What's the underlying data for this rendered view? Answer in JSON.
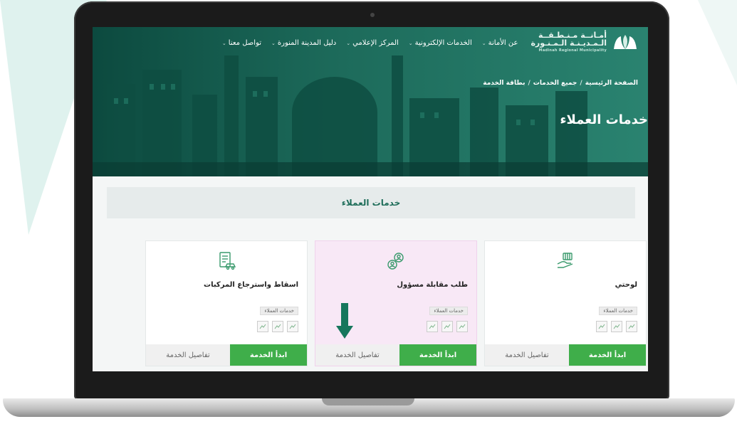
{
  "nav": {
    "logo": {
      "line1": "أمـانــة مـنـطـقــة",
      "line2": "الـمـديـنـة الـمـنـورة",
      "line3": "Madinah Regional Municipality"
    },
    "menu": [
      "عن الأمانة",
      "الخدمات الإلكترونية",
      "المركز الإعلامي",
      "دليل المدينة المنورة",
      "تواصل معنا"
    ]
  },
  "breadcrumb": [
    "الصفحة الرئيسية",
    "جميع الخدمات",
    "بطاقة الخدمة"
  ],
  "hero_title": "خدمات العملاء",
  "section_title": "خدمات العملاء",
  "cards": [
    {
      "title": "لوحتي",
      "tag": "خدمات العملاء",
      "start": "ابدأ الخدمة",
      "details": "تفاصيل الخدمة",
      "icon": "hand-card-icon"
    },
    {
      "title": "طلب مقابلة مسؤول",
      "tag": "خدمات العملاء",
      "start": "ابدأ الخدمة",
      "details": "تفاصيل الخدمة",
      "icon": "users-meeting-icon",
      "highlighted": true
    },
    {
      "title": "اسقاط واسترجاع المركبات",
      "tag": "خدمات العملاء",
      "start": "ابدأ الخدمة",
      "details": "تفاصيل الخدمة",
      "icon": "document-car-icon"
    }
  ],
  "colors": {
    "brand_green": "#1f6e5a",
    "button_green": "#3fae4a",
    "highlight": "#f8e8f6",
    "arrow": "#16775c"
  }
}
